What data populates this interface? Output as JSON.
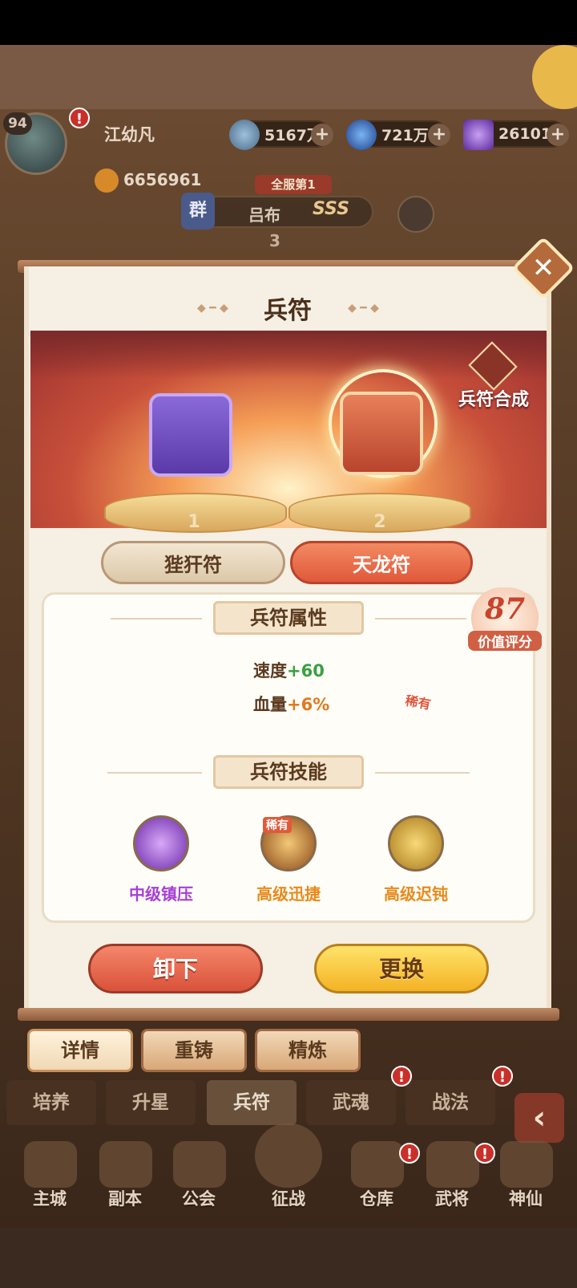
{
  "player": {
    "level": "94",
    "name": "江幼凡",
    "power": "6656961"
  },
  "currencies": [
    {
      "icon": "copper-coin-icon",
      "value": "5167万"
    },
    {
      "icon": "blue-orb-icon",
      "value": "721万"
    },
    {
      "icon": "purple-gem-icon",
      "value": "26101"
    }
  ],
  "hero": {
    "rank_tag": "全服第1",
    "group_label": "群",
    "name": "吕布",
    "grade": "SSS",
    "stars": "3"
  },
  "dialog": {
    "title": "兵符",
    "merge_label": "兵符合成",
    "slots": [
      {
        "number": "1"
      },
      {
        "number": "2"
      }
    ],
    "tabs": [
      {
        "label": "狴犴符",
        "active": false
      },
      {
        "label": "天龙符",
        "active": true
      }
    ],
    "attributes_header": "兵符属性",
    "attributes": [
      {
        "label": "速度",
        "value": "+60"
      },
      {
        "label": "血量",
        "value": "+6%"
      }
    ],
    "rarity_tag": "稀有",
    "score": {
      "value": "87",
      "label": "价值评分"
    },
    "skills_header": "兵符技能",
    "skills": [
      {
        "name": "中级镇压",
        "color": "#a63fd6",
        "icon": "purple-crystal-icon",
        "rare": ""
      },
      {
        "name": "高级迅捷",
        "color": "#e88a1a",
        "icon": "boot-icon",
        "rare": "稀有"
      },
      {
        "name": "高级迟钝",
        "color": "#e88a1a",
        "icon": "chain-icon",
        "rare": ""
      }
    ],
    "buttons": {
      "unload": "卸下",
      "replace": "更换"
    }
  },
  "sub_tabs": [
    "详情",
    "重铸",
    "精炼"
  ],
  "menu_tabs": [
    "培养",
    "升星",
    "兵符",
    "武魂",
    "战法"
  ],
  "nav": [
    "主城",
    "副本",
    "公会",
    "征战",
    "仓库",
    "武将",
    "神仙"
  ]
}
